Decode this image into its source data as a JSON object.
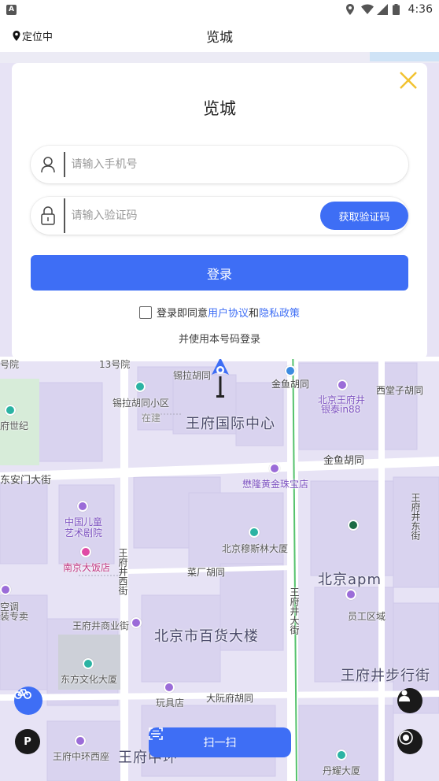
{
  "status_bar": {
    "app_icon": "A",
    "time": "4:36",
    "icons": [
      "location-icon",
      "wifi-icon",
      "signal-icon",
      "battery-icon"
    ]
  },
  "header": {
    "location_label": "定位中",
    "title": "览城"
  },
  "login": {
    "title": "览城",
    "phone_placeholder": "请输入手机号",
    "code_placeholder": "请输入验证码",
    "get_code_label": "获取验证码",
    "login_label": "登录",
    "agree_prefix": "登录即同意",
    "user_agreement": "用户协议",
    "and": "和",
    "privacy_policy": "隐私政策",
    "sub_note": "并使用本号码登录",
    "accent_color": "#3e6ef5"
  },
  "map": {
    "labels": {
      "l1": "13号院",
      "l2": "锡拉胡同",
      "l3": "锡拉胡同小区",
      "l4": "金鱼胡同",
      "l5": "北京王府井",
      "l6": "银泰in88",
      "l7": "西堂子胡同",
      "l8": "王府国际中心",
      "l9": "府世纪",
      "l10": "东安门大街",
      "l11": "金鱼胡同",
      "l12": "懋隆黄金珠宝店",
      "l13": "中国儿童",
      "l14": "艺术剧院",
      "l15": "北京穆斯林大厦",
      "l16": "南京大饭店",
      "l17": "王府井西街",
      "l18": "菜厂胡同",
      "l19": "北京apm",
      "l20": "员工区域",
      "l21": "王府井商业街",
      "l22": "北京市百货大楼",
      "l23": "王府井大街",
      "l24": "王府井步行街",
      "l25": "东方文化大厦",
      "l26": "玩具店",
      "l27": "大阮府胡同",
      "l28": "王府中环西座",
      "l29": "王府中环",
      "l30": "丹耀大厦",
      "l31": "号院",
      "l32": "空调",
      "l33": "装专卖",
      "l34": "王府井东街",
      "l35": "在建"
    }
  },
  "controls": {
    "scan_label": "扫一扫",
    "parking_label": "P"
  }
}
